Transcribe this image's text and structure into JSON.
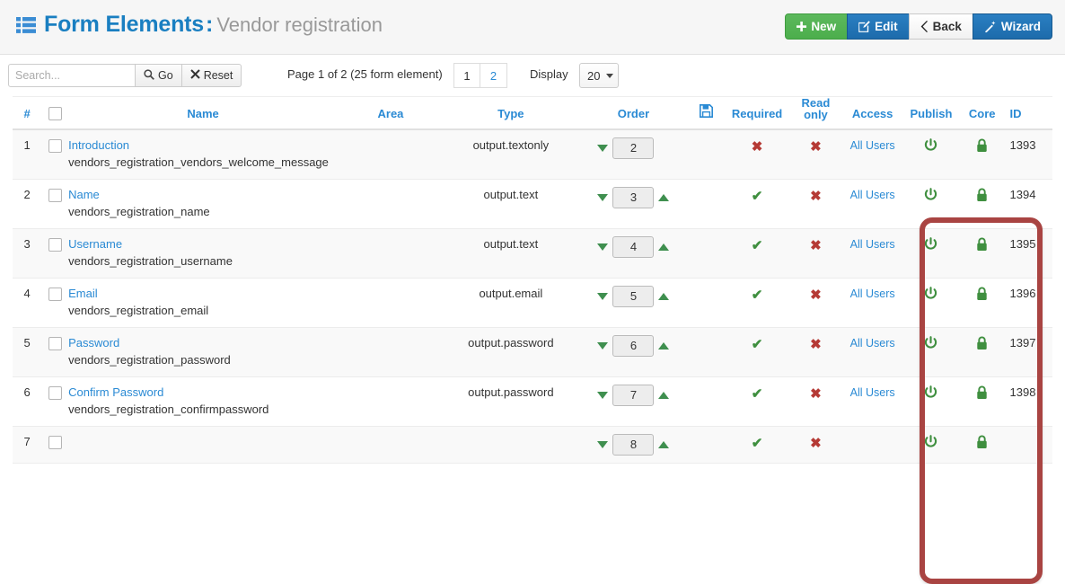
{
  "header": {
    "icon": "list-icon",
    "title": "Form Elements",
    "separator": ":",
    "subtitle": "Vendor registration",
    "buttons": [
      {
        "label": "New",
        "icon": "plus-icon",
        "style": "green"
      },
      {
        "label": "Edit",
        "icon": "pencil-square-icon",
        "style": "blue"
      },
      {
        "label": "Back",
        "icon": "chevron-left-icon",
        "style": "white"
      },
      {
        "label": "Wizard",
        "icon": "magic-wand-icon",
        "style": "blue"
      }
    ]
  },
  "toolbar": {
    "search_placeholder": "Search...",
    "search_value": "",
    "go_label": "Go",
    "go_icon": "search-icon",
    "reset_label": "Reset",
    "reset_icon": "close-x-icon",
    "page_info": "Page 1 of 2 (25 form element)",
    "pages": [
      "1",
      "2"
    ],
    "active_page": "1",
    "display_label": "Display",
    "display_value": "20"
  },
  "table": {
    "columns": {
      "num": "#",
      "name": "Name",
      "area": "Area",
      "type": "Type",
      "order": "Order",
      "save_icon": "floppy-save-icon",
      "required": "Required",
      "readonly_line1": "Read",
      "readonly_line2": "only",
      "access": "Access",
      "publish": "Publish",
      "core": "Core",
      "id": "ID"
    },
    "rows": [
      {
        "num": "1",
        "name": "Introduction",
        "code": "vendors_registration_vendors_welcome_message",
        "area": "",
        "type": "output.textonly",
        "order": "2",
        "has_up": false,
        "has_down": true,
        "required": "x",
        "readonly": "x",
        "access": "All Users",
        "publish": "on",
        "core": "locked",
        "id": "1393"
      },
      {
        "num": "2",
        "name": "Name",
        "code": "vendors_registration_name",
        "area": "",
        "type": "output.text",
        "order": "3",
        "has_up": true,
        "has_down": true,
        "required": "v",
        "readonly": "x",
        "access": "All Users",
        "publish": "on",
        "core": "locked",
        "id": "1394"
      },
      {
        "num": "3",
        "name": "Username",
        "code": "vendors_registration_username",
        "area": "",
        "type": "output.text",
        "order": "4",
        "has_up": true,
        "has_down": true,
        "required": "v",
        "readonly": "x",
        "access": "All Users",
        "publish": "on",
        "core": "locked",
        "id": "1395"
      },
      {
        "num": "4",
        "name": "Email",
        "code": "vendors_registration_email",
        "area": "",
        "type": "output.email",
        "order": "5",
        "has_up": true,
        "has_down": true,
        "required": "v",
        "readonly": "x",
        "access": "All Users",
        "publish": "on",
        "core": "locked",
        "id": "1396"
      },
      {
        "num": "5",
        "name": "Password",
        "code": "vendors_registration_password",
        "area": "",
        "type": "output.password",
        "order": "6",
        "has_up": true,
        "has_down": true,
        "required": "v",
        "readonly": "x",
        "access": "All Users",
        "publish": "on",
        "core": "locked",
        "id": "1397"
      },
      {
        "num": "6",
        "name": "Confirm Password",
        "code": "vendors_registration_confirmpassword",
        "area": "",
        "type": "output.password",
        "order": "7",
        "has_up": true,
        "has_down": true,
        "required": "v",
        "readonly": "x",
        "access": "All Users",
        "publish": "on",
        "core": "locked",
        "id": "1398"
      },
      {
        "num": "7",
        "name": "",
        "code": "",
        "area": "",
        "type": "",
        "order": "8",
        "has_up": true,
        "has_down": true,
        "required": "v",
        "readonly": "x",
        "access": "",
        "publish": "on",
        "core": "locked",
        "id": ""
      }
    ]
  },
  "annotation": {
    "highlight_color": "#a94442",
    "highlight_target": "Publish and Core columns"
  },
  "colors": {
    "link": "#2a8ad4",
    "green": "#3f8f3f",
    "red": "#b53a35",
    "brand_blue": "#1a7fc1"
  }
}
